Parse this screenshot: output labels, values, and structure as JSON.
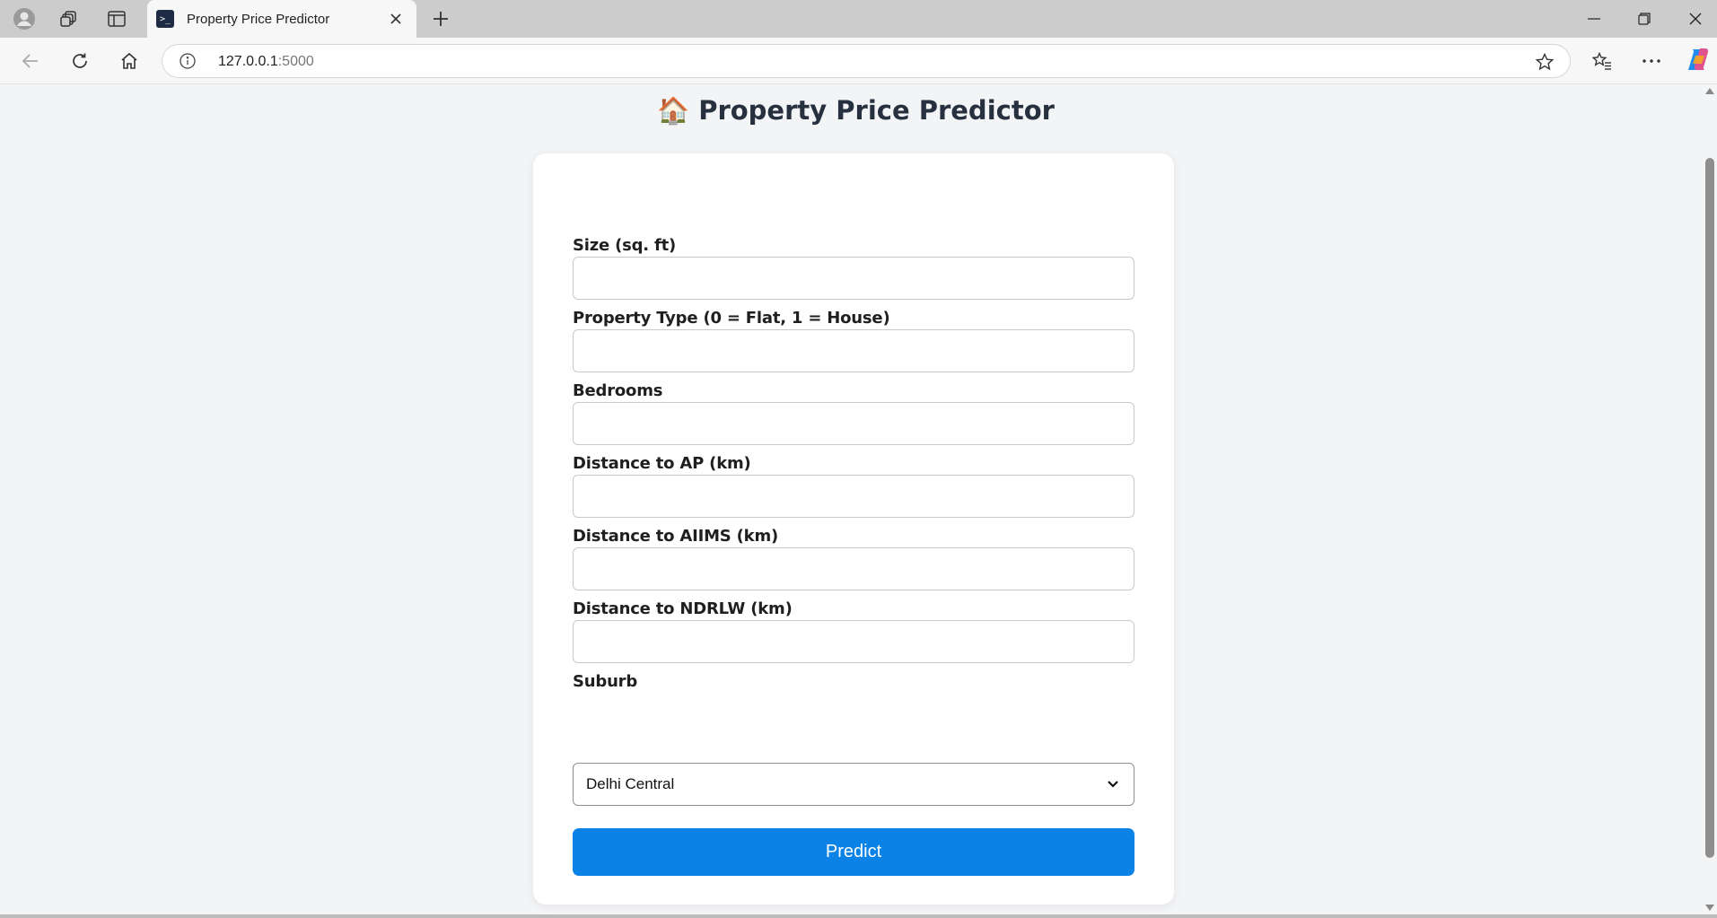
{
  "browser": {
    "tab": {
      "title": "Property Price Predictor",
      "favicon": "terminal-favicon"
    },
    "address": {
      "host": "127.0.0.1",
      "port": ":5000"
    },
    "icons": [
      "profile-icon",
      "workspaces-icon",
      "tab-actions-icon",
      "close-icon",
      "new-tab-icon",
      "minimize-icon",
      "restore-icon",
      "window-close-icon",
      "back-icon",
      "refresh-icon",
      "home-icon",
      "site-info-icon",
      "favorite-star-icon",
      "favorites-icon",
      "more-icon",
      "copilot-icon"
    ]
  },
  "page": {
    "title_icon": "🏠",
    "title": "Property Price Predictor",
    "fields": [
      {
        "label": "Size (sq. ft)",
        "value": ""
      },
      {
        "label": "Property Type (0 = Flat, 1 = House)",
        "value": ""
      },
      {
        "label": "Bedrooms",
        "value": ""
      },
      {
        "label": "Distance to AP (km)",
        "value": ""
      },
      {
        "label": "Distance to AIIMS (km)",
        "value": ""
      },
      {
        "label": "Distance to NDRLW (km)",
        "value": ""
      }
    ],
    "suburb": {
      "label": "Suburb",
      "selected": "Delhi Central"
    },
    "submit_label": "Predict"
  },
  "colors": {
    "page_background": "#f3f4f6",
    "card_background": "#ffffff",
    "button": "#0b82e6",
    "title_text": "#27303f"
  }
}
